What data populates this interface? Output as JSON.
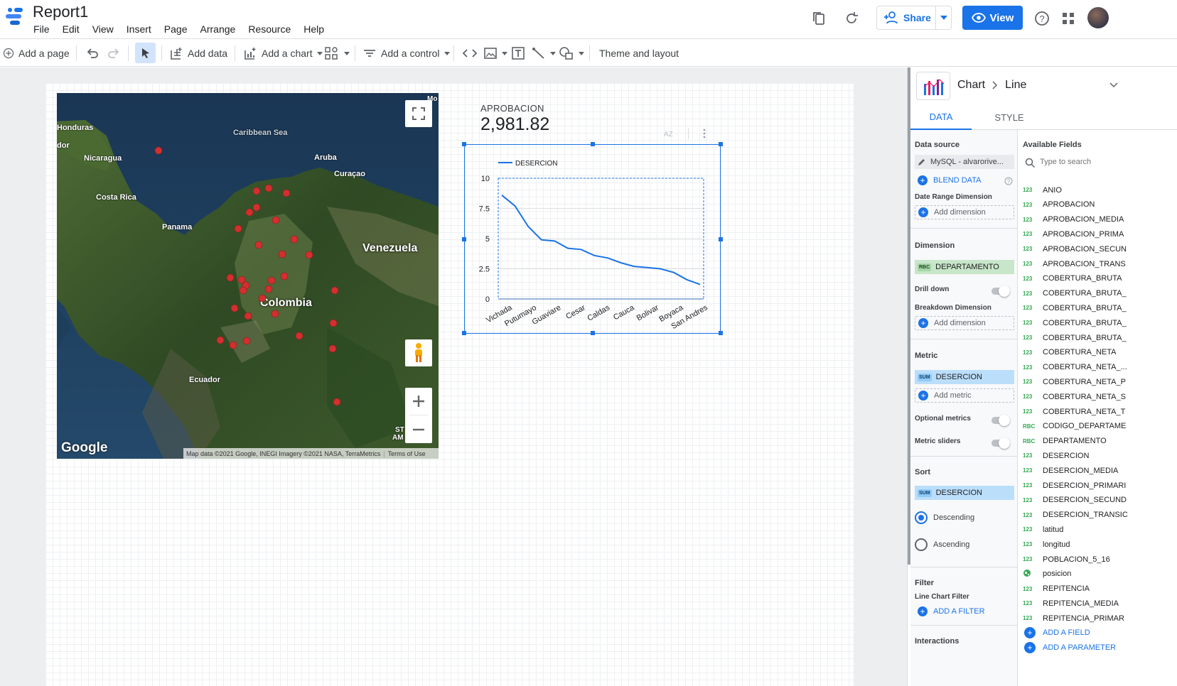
{
  "app": {
    "title": "Report1"
  },
  "menu": [
    "File",
    "Edit",
    "View",
    "Insert",
    "Page",
    "Arrange",
    "Resource",
    "Help"
  ],
  "header": {
    "share_label": "Share",
    "view_label": "View"
  },
  "toolbar": {
    "add_page": "Add a page",
    "add_data": "Add data",
    "add_chart": "Add a chart",
    "add_control": "Add a control",
    "theme_layout": "Theme and layout"
  },
  "map": {
    "labels": {
      "honduras": "Honduras",
      "dor": "dor",
      "caribbean": "Caribbean Sea",
      "nicaragua": "Nicaragua",
      "aruba": "Aruba",
      "curacao": "Curaçao",
      "costa_rica": "Costa Rica",
      "panama": "Panama",
      "venezuela": "Venezuela",
      "colombia": "Colombia",
      "ecuador": "Ecuador",
      "mo": "Mo",
      "st": "ST",
      "am": "AM"
    },
    "brand": "Google",
    "attribution": "Map data ©2021 Google, INEGI Imagery ©2021 NASA, TerraMetrics",
    "terms": "Terms of Use"
  },
  "scorecard": {
    "label": "APROBACION",
    "value": "2,981.82"
  },
  "chart_data": {
    "type": "line",
    "categories": [
      "Vichada",
      "Putumayo",
      "Guaviare",
      "Cesar",
      "Caldas",
      "Cauca",
      "Bolivar",
      "Boyaca",
      "San Andres"
    ],
    "x_tick_labels_shown": [
      "Vichada",
      "Putumayo",
      "Guaviare",
      "Cesar",
      "Caldas",
      "Cauca",
      "Bolivar",
      "Boyaca",
      "San Andres"
    ],
    "series": [
      {
        "name": "DESERCION",
        "values": [
          8.6,
          7.7,
          6.0,
          4.9,
          4.8,
          4.2,
          4.1,
          3.6,
          3.4,
          3.0,
          2.7,
          2.6,
          2.5,
          2.2,
          1.6,
          1.2
        ],
        "color": "#1a73e8"
      }
    ],
    "yticks": [
      "10",
      "7.5",
      "5",
      "2.5",
      "0"
    ],
    "ylim": [
      0,
      10
    ],
    "grid": true,
    "legend": "top-left"
  },
  "panel": {
    "crumb_chart": "Chart",
    "crumb_type": "Line",
    "tab_data": "DATA",
    "tab_style": "STYLE",
    "data_source_label": "Data source",
    "data_source_value": "MySQL - alvarorive...",
    "blend_data": "BLEND DATA",
    "date_range_label": "Date Range Dimension",
    "add_dimension": "Add dimension",
    "dimension_label": "Dimension",
    "dimension_tag": "RBC",
    "dimension_value": "DEPARTAMENTO",
    "drill_down": "Drill down",
    "breakdown_label": "Breakdown Dimension",
    "add_dimension_2": "Add dimension",
    "metric_label": "Metric",
    "metric_tag": "SUM",
    "metric_value": "DESERCION",
    "add_metric": "Add metric",
    "optional_metrics": "Optional metrics",
    "metric_sliders": "Metric sliders",
    "sort_label": "Sort",
    "sort_tag": "SUM",
    "sort_value": "DESERCION",
    "descending": "Descending",
    "ascending": "Ascending",
    "filter_label": "Filter",
    "line_chart_filter": "Line Chart Filter",
    "add_filter": "ADD A FILTER",
    "interactions": "Interactions",
    "available_fields": "Available Fields",
    "search_placeholder": "Type to search",
    "add_field": "ADD A FIELD",
    "add_parameter": "ADD A PARAMETER",
    "fields": [
      {
        "t": "123",
        "n": "ANIO"
      },
      {
        "t": "123",
        "n": "APROBACION"
      },
      {
        "t": "123",
        "n": "APROBACION_MEDIA"
      },
      {
        "t": "123",
        "n": "APROBACION_PRIMA"
      },
      {
        "t": "123",
        "n": "APROBACION_SECUN"
      },
      {
        "t": "123",
        "n": "APROBACION_TRANS"
      },
      {
        "t": "123",
        "n": "COBERTURA_BRUTA"
      },
      {
        "t": "123",
        "n": "COBERTURA_BRUTA_"
      },
      {
        "t": "123",
        "n": "COBERTURA_BRUTA_"
      },
      {
        "t": "123",
        "n": "COBERTURA_BRUTA_"
      },
      {
        "t": "123",
        "n": "COBERTURA_BRUTA_"
      },
      {
        "t": "123",
        "n": "COBERTURA_NETA"
      },
      {
        "t": "123",
        "n": "COBERTURA_NETA_..."
      },
      {
        "t": "123",
        "n": "COBERTURA_NETA_P"
      },
      {
        "t": "123",
        "n": "COBERTURA_NETA_S"
      },
      {
        "t": "123",
        "n": "COBERTURA_NETA_T"
      },
      {
        "t": "RBC",
        "n": "CODIGO_DEPARTAME"
      },
      {
        "t": "RBC",
        "n": "DEPARTAMENTO"
      },
      {
        "t": "123",
        "n": "DESERCION"
      },
      {
        "t": "123",
        "n": "DESERCION_MEDIA"
      },
      {
        "t": "123",
        "n": "DESERCION_PRIMARI"
      },
      {
        "t": "123",
        "n": "DESERCION_SECUND"
      },
      {
        "t": "123",
        "n": "DESERCION_TRANSIC"
      },
      {
        "t": "123",
        "n": "latitud"
      },
      {
        "t": "123",
        "n": "longitud"
      },
      {
        "t": "123",
        "n": "POBLACION_5_16"
      },
      {
        "t": "geo",
        "n": "posicion"
      },
      {
        "t": "123",
        "n": "REPITENCIA"
      },
      {
        "t": "123",
        "n": "REPITENCIA_MEDIA"
      },
      {
        "t": "123",
        "n": "REPITENCIA_PRIMAR"
      }
    ]
  },
  "colors": {
    "accent": "#1a73e8",
    "marker": "#d32f2f",
    "dimension_chip": "#c8e6c9",
    "metric_chip": "#bbdefb"
  }
}
